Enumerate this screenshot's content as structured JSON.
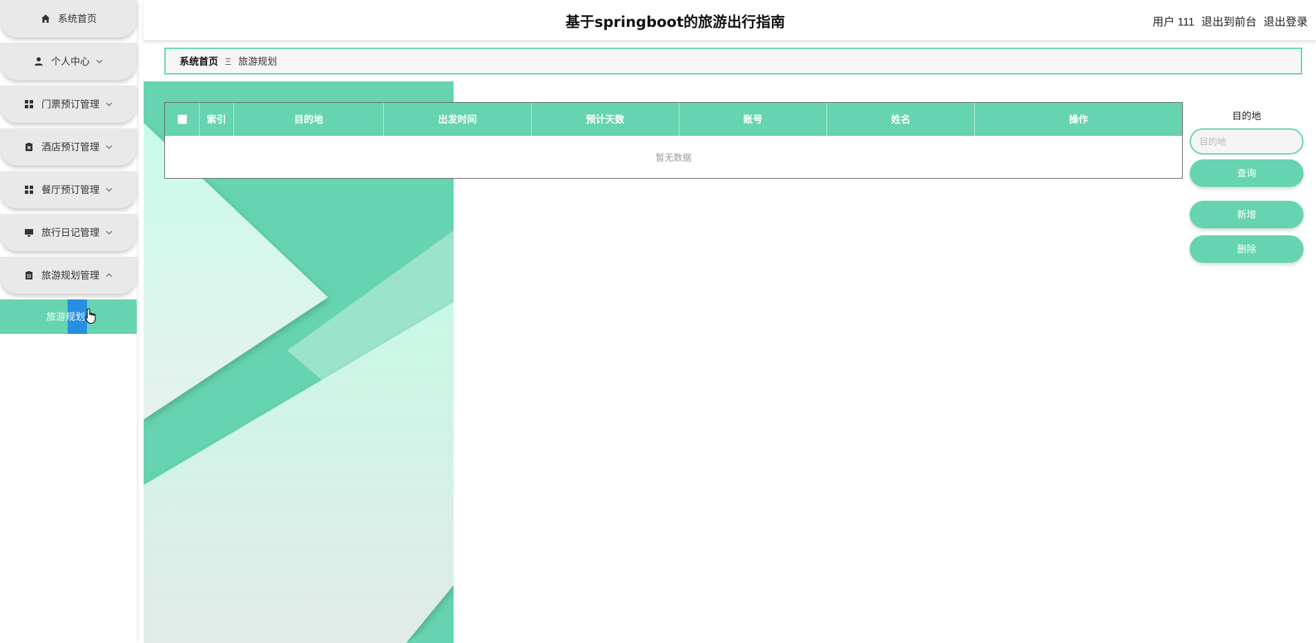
{
  "header": {
    "title": "基于springboot的旅游出行指南",
    "user": "用户 111",
    "to_front": "退出到前台",
    "logout": "退出登录"
  },
  "sidebar": {
    "items": [
      {
        "label": "系统首页",
        "icon": "home-icon"
      },
      {
        "label": "个人中心",
        "icon": "person-icon"
      },
      {
        "label": "门票预订管理",
        "icon": "grid-icon"
      },
      {
        "label": "酒店预订管理",
        "icon": "clipboard-x-icon"
      },
      {
        "label": "餐厅预订管理",
        "icon": "grid-icon"
      },
      {
        "label": "旅行日记管理",
        "icon": "monitor-icon"
      },
      {
        "label": "旅游规划管理",
        "icon": "clipboard-icon"
      }
    ],
    "submenu": {
      "label": "旅游规划"
    }
  },
  "breadcrumb": {
    "home": "系统首页",
    "separator": "Ξ",
    "current": "旅游规划"
  },
  "table": {
    "columns": [
      "索引",
      "目的地",
      "出发时间",
      "预计天数",
      "账号",
      "姓名",
      "操作"
    ],
    "empty_text": "暂无数据"
  },
  "search": {
    "label": "目的地",
    "placeholder": "目的地",
    "value": "",
    "search_button": "查询",
    "add_button": "新增",
    "delete_button": "删除"
  },
  "colors": {
    "accent": "#66d4b0",
    "selection": "#1e88e5"
  }
}
